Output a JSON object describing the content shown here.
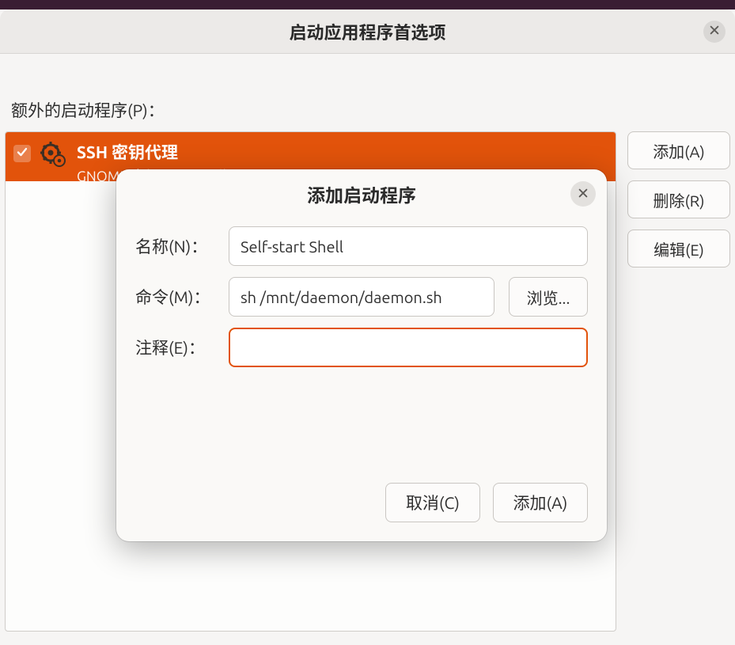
{
  "window": {
    "title": "启动应用程序首选项"
  },
  "section_label": "额外的启动程序(P)：",
  "list": {
    "items": [
      {
        "checked": true,
        "title": "SSH 密钥代理",
        "subtitle": "GNOME 密钥环：SSH 代理"
      }
    ]
  },
  "side": {
    "add": "添加(A)",
    "remove": "删除(R)",
    "edit": "编辑(E)"
  },
  "modal": {
    "title": "添加启动程序",
    "labels": {
      "name": "名称(N)：",
      "command": "命令(M)：",
      "comment": "注释(E)："
    },
    "values": {
      "name": "Self-start Shell",
      "command": "sh /mnt/daemon/daemon.sh",
      "comment": ""
    },
    "browse": "浏览...",
    "cancel": "取消(C)",
    "add": "添加(A)"
  }
}
